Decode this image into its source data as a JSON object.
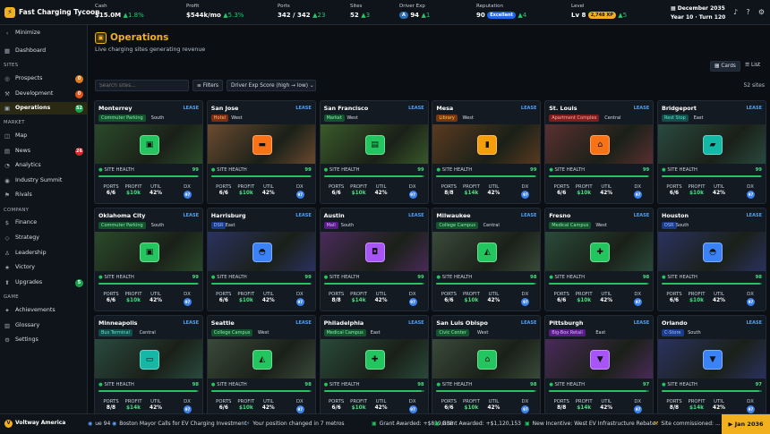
{
  "app": {
    "title": "Fast Charging Tycoon",
    "logo_icon": "bolt-icon"
  },
  "stats": [
    {
      "label": "Cash",
      "value": "$15.0M",
      "delta": "1.8%"
    },
    {
      "label": "Profit",
      "value": "$544k/mo",
      "delta": "5.3%"
    },
    {
      "label": "Ports",
      "value": "342 / 342",
      "delta": "23"
    },
    {
      "label": "Sites",
      "value": "52",
      "delta": "3"
    },
    {
      "label": "Driver Exp",
      "value": "94",
      "delta": "1",
      "badge": "A"
    },
    {
      "label": "Reputation",
      "value": "90",
      "chip": "Excellent",
      "delta": "4"
    },
    {
      "label": "Level",
      "value": "Lv 8",
      "chip": "2,748 XP",
      "delta": "5"
    }
  ],
  "date": {
    "month": "December 2035",
    "turn": "Year 10 · Turn 120"
  },
  "sidebar": {
    "minimize": "Minimize",
    "dashboard": "Dashboard",
    "sections": {
      "sites": "SITES",
      "market": "MARKET",
      "company": "COMPANY",
      "game": "GAME"
    },
    "sites": [
      {
        "label": "Prospects",
        "badge": "0",
        "badge_color": "#e07b1a"
      },
      {
        "label": "Development",
        "badge": "0",
        "badge_color": "#e0541a"
      },
      {
        "label": "Operations",
        "badge": "52",
        "badge_color": "#16a34a"
      }
    ],
    "market": [
      {
        "label": "Map"
      },
      {
        "label": "News",
        "badge": "26",
        "badge_color": "#dc2626"
      },
      {
        "label": "Analytics"
      },
      {
        "label": "Industry Summit"
      },
      {
        "label": "Rivals"
      }
    ],
    "company": [
      {
        "label": "Finance"
      },
      {
        "label": "Strategy"
      },
      {
        "label": "Leadership"
      },
      {
        "label": "Victory"
      },
      {
        "label": "Upgrades",
        "badge": "5",
        "badge_color": "#16a34a"
      }
    ],
    "game": [
      {
        "label": "Achievements"
      },
      {
        "label": "Glossary"
      },
      {
        "label": "Settings"
      }
    ]
  },
  "page": {
    "title": "Operations",
    "subtitle": "Live charging sites generating revenue",
    "view_cards": "Cards",
    "view_list": "List",
    "search_placeholder": "Search sites...",
    "filters": "Filters",
    "sort": "Driver Exp Score (high → low)",
    "count": "52 sites"
  },
  "card_labels": {
    "lease": "LEASE",
    "health": "SITE HEALTH",
    "ports": "PORTS",
    "profit": "PROFIT",
    "util": "UTIL",
    "dx": "DX"
  },
  "cards": [
    {
      "name": "Monterrey",
      "tag": "Commuter Parking",
      "tag_color": "#14532d",
      "tag_text": "#86efac",
      "region": "South",
      "icon": "parking-icon",
      "icon_color": "#22c55e",
      "img": "#2a4a2a",
      "health": "99",
      "ports": "6/6",
      "profit": "$10k",
      "util": "42%",
      "dx": "97"
    },
    {
      "name": "San Jose",
      "tag": "Hotel",
      "tag_color": "#7c2d12",
      "tag_text": "#fdba74",
      "region": "West",
      "icon": "bed-icon",
      "icon_color": "#f97316",
      "img": "#6b4a30",
      "health": "99",
      "ports": "6/6",
      "profit": "$10k",
      "util": "42%",
      "dx": "97"
    },
    {
      "name": "San Francisco",
      "tag": "Market",
      "tag_color": "#14532d",
      "tag_text": "#86efac",
      "region": "West",
      "icon": "store-icon",
      "icon_color": "#22c55e",
      "img": "#3a5a2a",
      "health": "99",
      "ports": "6/6",
      "profit": "$10k",
      "util": "42%",
      "dx": "97"
    },
    {
      "name": "Mesa",
      "tag": "Library",
      "tag_color": "#78350f",
      "tag_text": "#fcd34d",
      "region": "West",
      "icon": "book-icon",
      "icon_color": "#f59e0b",
      "img": "#5a3a20",
      "health": "99",
      "ports": "8/8",
      "profit": "$14k",
      "util": "42%",
      "dx": "97"
    },
    {
      "name": "St. Louis",
      "tag": "Apartment Complex",
      "tag_color": "#7f1d1d",
      "tag_text": "#fca5a5",
      "region": "Central",
      "icon": "home-icon",
      "icon_color": "#f97316",
      "img": "#5a3030",
      "health": "99",
      "ports": "6/6",
      "profit": "$10k",
      "util": "42%",
      "dx": "97"
    },
    {
      "name": "Bridgeport",
      "tag": "Rest Stop",
      "tag_color": "#134e4a",
      "tag_text": "#5eead4",
      "region": "East",
      "icon": "truck-icon",
      "icon_color": "#14b8a6",
      "img": "#2a4a40",
      "health": "99",
      "ports": "6/6",
      "profit": "$10k",
      "util": "42%",
      "dx": "97"
    },
    {
      "name": "Oklahoma City",
      "tag": "Commuter Parking",
      "tag_color": "#14532d",
      "tag_text": "#86efac",
      "region": "South",
      "icon": "parking-icon",
      "icon_color": "#22c55e",
      "img": "#2a4a2a",
      "health": "99",
      "ports": "6/6",
      "profit": "$10k",
      "util": "42%",
      "dx": "97"
    },
    {
      "name": "Harrisburg",
      "tag": "DSR",
      "tag_color": "#1e3a8a",
      "tag_text": "#93c5fd",
      "region": "East",
      "icon": "car-icon",
      "icon_color": "#3b82f6",
      "img": "#2a3260",
      "health": "99",
      "ports": "6/6",
      "profit": "$10k",
      "util": "42%",
      "dx": "97"
    },
    {
      "name": "Austin",
      "tag": "Mall",
      "tag_color": "#581c87",
      "tag_text": "#d8b4fe",
      "region": "South",
      "icon": "bag-icon",
      "icon_color": "#a855f7",
      "img": "#4a2a5a",
      "health": "99",
      "ports": "8/8",
      "profit": "$14k",
      "util": "42%",
      "dx": "97"
    },
    {
      "name": "Milwaukee",
      "tag": "College Campus",
      "tag_color": "#14532d",
      "tag_text": "#86efac",
      "region": "Central",
      "icon": "cap-icon",
      "icon_color": "#22c55e",
      "img": "#3a4a3a",
      "health": "98",
      "ports": "6/6",
      "profit": "$10k",
      "util": "42%",
      "dx": "97"
    },
    {
      "name": "Fresno",
      "tag": "Medical Campus",
      "tag_color": "#14532d",
      "tag_text": "#86efac",
      "region": "West",
      "icon": "medical-icon",
      "icon_color": "#22c55e",
      "img": "#2a4a3a",
      "health": "98",
      "ports": "6/6",
      "profit": "$10k",
      "util": "42%",
      "dx": "97"
    },
    {
      "name": "Houston",
      "tag": "DSR",
      "tag_color": "#1e3a8a",
      "tag_text": "#93c5fd",
      "region": "South",
      "icon": "car-icon",
      "icon_color": "#3b82f6",
      "img": "#2a3260",
      "health": "98",
      "ports": "6/6",
      "profit": "$10k",
      "util": "42%",
      "dx": "97"
    },
    {
      "name": "Minneapolis",
      "tag": "Bus Terminal",
      "tag_color": "#134e4a",
      "tag_text": "#5eead4",
      "region": "Central",
      "icon": "bus-icon",
      "icon_color": "#14b8a6",
      "img": "#2a4a40",
      "health": "98",
      "ports": "8/8",
      "profit": "$14k",
      "util": "42%",
      "dx": "97"
    },
    {
      "name": "Seattle",
      "tag": "College Campus",
      "tag_color": "#14532d",
      "tag_text": "#86efac",
      "region": "West",
      "icon": "cap-icon",
      "icon_color": "#22c55e",
      "img": "#3a4a3a",
      "health": "98",
      "ports": "6/6",
      "profit": "$10k",
      "util": "42%",
      "dx": "97"
    },
    {
      "name": "Philadelphia",
      "tag": "Medical Campus",
      "tag_color": "#14532d",
      "tag_text": "#86efac",
      "region": "East",
      "icon": "medical-icon",
      "icon_color": "#22c55e",
      "img": "#2a4a3a",
      "health": "98",
      "ports": "6/6",
      "profit": "$10k",
      "util": "42%",
      "dx": "97"
    },
    {
      "name": "San Luis Obispo",
      "tag": "Civic Center",
      "tag_color": "#14532d",
      "tag_text": "#86efac",
      "region": "West",
      "icon": "civic-icon",
      "icon_color": "#22c55e",
      "img": "#3a4a3a",
      "health": "98",
      "ports": "6/6",
      "profit": "$10k",
      "util": "42%",
      "dx": "97"
    },
    {
      "name": "Pittsburgh",
      "tag": "Big-Box Retail",
      "tag_color": "#581c87",
      "tag_text": "#d8b4fe",
      "region": "East",
      "icon": "cart-icon",
      "icon_color": "#a855f7",
      "img": "#4a2a5a",
      "health": "97",
      "ports": "8/8",
      "profit": "$14k",
      "util": "42%",
      "dx": "97"
    },
    {
      "name": "Orlando",
      "tag": "C-Store",
      "tag_color": "#1e3a8a",
      "tag_text": "#93c5fd",
      "region": "South",
      "icon": "cart-icon",
      "icon_color": "#3b82f6",
      "img": "#2a3260",
      "health": "97",
      "ports": "8/8",
      "profit": "$14k",
      "util": "42%",
      "dx": "97"
    }
  ],
  "footer": {
    "company": "Voltway America",
    "ticker": [
      {
        "icon": "news-icon",
        "text": "ue 94"
      },
      {
        "icon": "news-icon",
        "text": "Boston Mayor Calls for EV Charging Investment"
      },
      {
        "icon": "bolt-icon",
        "text": "Your position changed in 7 metros"
      },
      {
        "icon": "money-icon",
        "text": "Grant Awarded: +$819,838"
      },
      {
        "icon": "money-icon",
        "text": "Grant Awarded: +$1,120,153"
      },
      {
        "icon": "money-icon",
        "text": "New Incentive: West EV Infrastructure Rebate"
      },
      {
        "icon": "wrench-icon",
        "text": "Site commissioned: ..."
      }
    ],
    "end_turn": "Jan 2036"
  }
}
